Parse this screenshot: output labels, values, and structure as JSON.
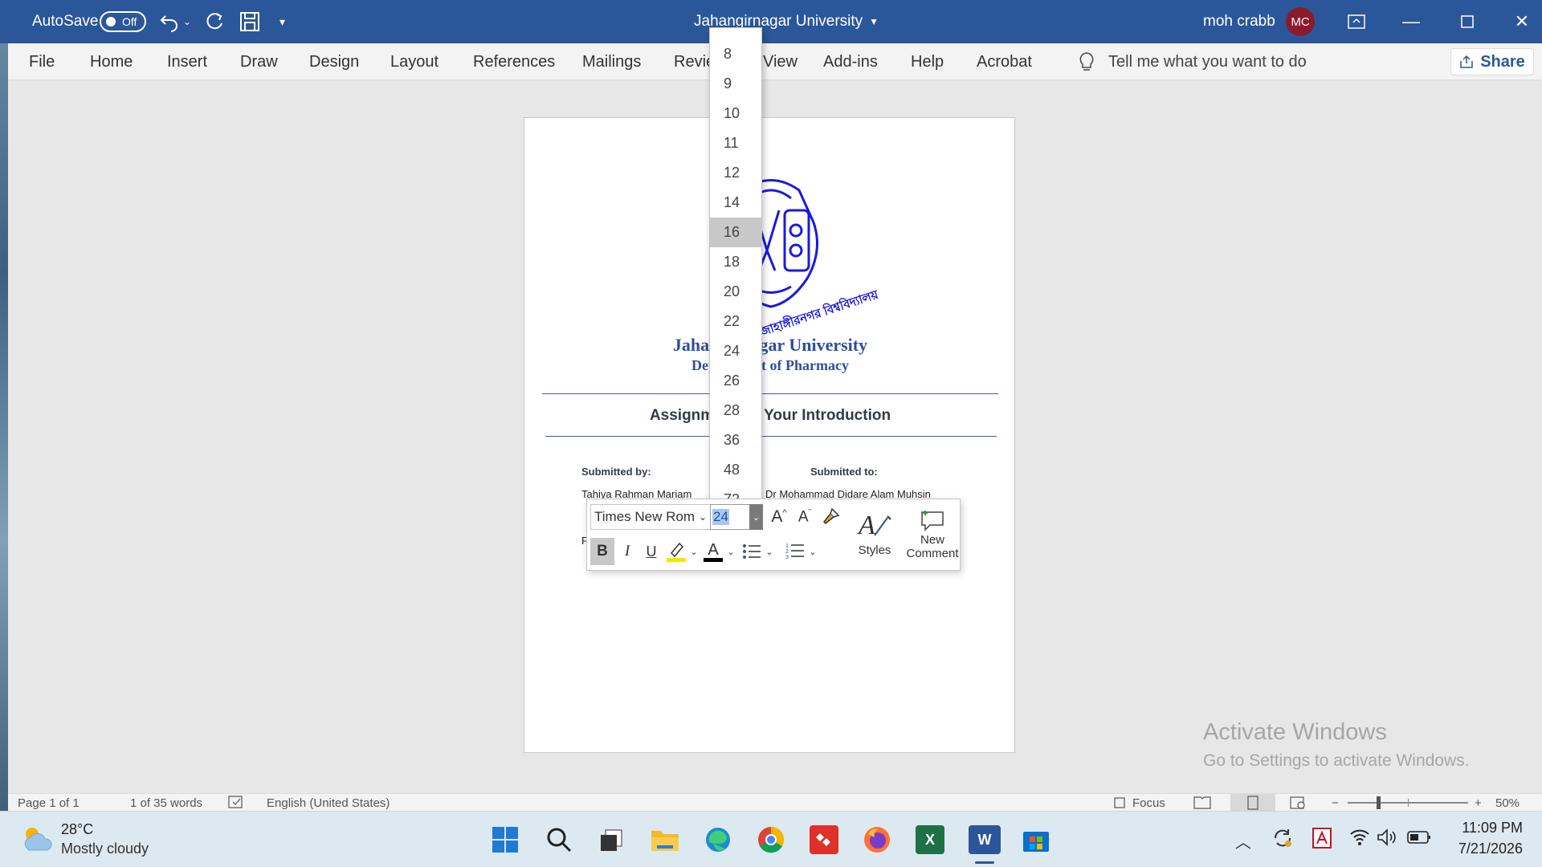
{
  "titlebar": {
    "autosave_label": "AutoSave",
    "autosave_state": "Off",
    "doc_title": "Jahangirnagar University",
    "user_name": "moh crabb",
    "user_initials": "MC"
  },
  "ribbon": {
    "tabs": [
      "File",
      "Home",
      "Insert",
      "Draw",
      "Design",
      "Layout",
      "References",
      "Mailings",
      "Revie",
      "View",
      "Add-ins",
      "Help",
      "Acrobat"
    ],
    "tell_me": "Tell me what you want to do",
    "share": "Share"
  },
  "document": {
    "university": "Jahangirnagar University",
    "department": "Department of Pharmacy",
    "logo_text": "জাহাঙ্গীরনগর বিশ্ববিদ্যালয়",
    "assignment": "Assignment on Your Introduction",
    "submitted_by_label": "Submitted by:",
    "submitted_to_label": "Submitted to:",
    "student_name": "Tahiya Rahman Mariam",
    "teacher_name": "Dr Mohammad Didare Alam Muhsin",
    "line_fragment": "F"
  },
  "font_dropdown": {
    "sizes": [
      "8",
      "9",
      "10",
      "11",
      "12",
      "14",
      "16",
      "18",
      "20",
      "22",
      "24",
      "26",
      "28",
      "36",
      "48",
      "72"
    ],
    "highlighted": "16"
  },
  "mini_toolbar": {
    "font_name": "Times New Rom",
    "font_size": "24",
    "bold": "B",
    "italic": "I",
    "underline": "U",
    "styles": "Styles",
    "new_comment_line1": "New",
    "new_comment_line2": "Comment",
    "highlight_color": "#f5e600",
    "font_color": "#000000"
  },
  "statusbar": {
    "page": "Page 1 of 1",
    "words": "1 of 35 words",
    "language": "English (United States)",
    "focus": "Focus",
    "zoom": "50%"
  },
  "watermark": {
    "line1": "Activate Windows",
    "line2": "Go to Settings to activate Windows."
  },
  "taskbar": {
    "temperature": "28°C",
    "weather": "Mostly cloudy",
    "time": "11:09 PM",
    "date": "7/21/2026"
  },
  "colors": {
    "title_blue": "#2b579a",
    "doc_blue": "#2e4e9e",
    "logo_blue": "#1a1ae0"
  }
}
